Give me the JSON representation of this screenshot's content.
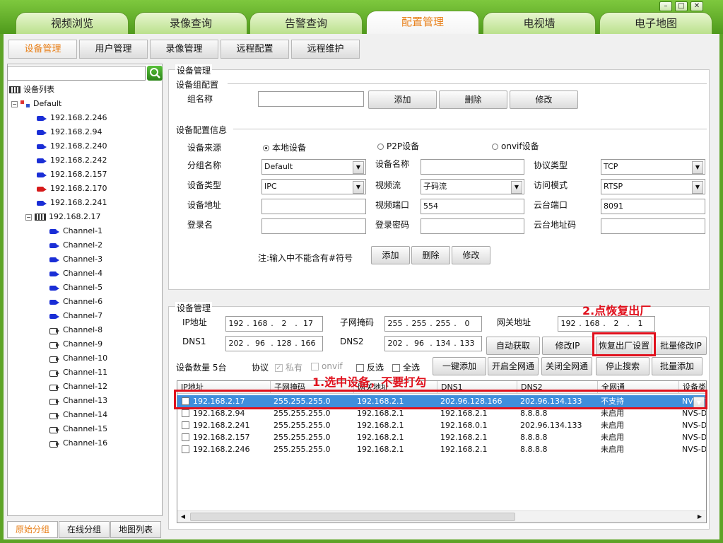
{
  "main_tabs": [
    "视频浏览",
    "录像查询",
    "告警查询",
    "配置管理",
    "电视墙",
    "电子地图"
  ],
  "window_buttons": [
    "–",
    "□",
    "✕"
  ],
  "sub_tabs": [
    "设备管理",
    "用户管理",
    "录像管理",
    "远程配置",
    "远程维护"
  ],
  "tree": {
    "root_label": "设备列表",
    "group_label": "Default",
    "devices": [
      "192.168.2.246",
      "192.168.2.94",
      "192.168.2.240",
      "192.168.2.242",
      "192.168.2.157",
      "192.168.2.170",
      "192.168.2.241"
    ],
    "nvr_label": "192.168.2.17",
    "channels": [
      "Channel-1",
      "Channel-2",
      "Channel-3",
      "Channel-4",
      "Channel-5",
      "Channel-6",
      "Channel-7",
      "Channel-8",
      "Channel-9",
      "Channel-10",
      "Channel-11",
      "Channel-12",
      "Channel-13",
      "Channel-14",
      "Channel-15",
      "Channel-16"
    ]
  },
  "bottom_tabs": [
    "原始分组",
    "在线分组",
    "地图列表"
  ],
  "device_config": {
    "title": "设备管理",
    "group_section": "设备组配置",
    "group_name_label": "组名称",
    "add": "添加",
    "delete": "删除",
    "modify": "修改",
    "info_section": "设备配置信息",
    "source_label": "设备来源",
    "source_local": "本地设备",
    "source_p2p": "P2P设备",
    "source_onvif": "onvif设备",
    "group_label": "分组名称",
    "group_value": "Default",
    "device_name_label": "设备名称",
    "protocol_label": "协议类型",
    "protocol_value": "TCP",
    "device_type_label": "设备类型",
    "device_type_value": "IPC",
    "stream_label": "视频流",
    "stream_value": "子码流",
    "access_label": "访问模式",
    "access_value": "RTSP",
    "address_label": "设备地址",
    "video_port_label": "视频端口",
    "video_port_value": "554",
    "ptz_port_label": "云台端口",
    "ptz_port_value": "8091",
    "login_label": "登录名",
    "password_label": "登录密码",
    "ptz_addr_label": "云台地址码",
    "note": "注:输入中不能含有#符号"
  },
  "net_config": {
    "title": "设备管理",
    "ip_label": "IP地址",
    "ip": [
      "192",
      "168",
      "2",
      "17"
    ],
    "mask_label": "子网掩码",
    "mask": [
      "255",
      "255",
      "255",
      "0"
    ],
    "gateway_label": "网关地址",
    "gateway": [
      "192",
      "168",
      "2",
      "1"
    ],
    "dns1_label": "DNS1",
    "dns1": [
      "202",
      "96",
      "128",
      "166"
    ],
    "dns2_label": "DNS2",
    "dns2": [
      "202",
      "96",
      "134",
      "133"
    ],
    "auto_get": "自动获取",
    "modify_ip": "修改IP",
    "factory_reset": "恢复出厂设置",
    "batch_modify_ip": "批量修改IP",
    "count_label": "设备数量",
    "count_value": "5台",
    "protocol_label": "协议",
    "private": "私有",
    "onvif": "onvif",
    "invert": "反选",
    "select_all": "全选",
    "one_click_add": "一键添加",
    "open_all": "开启全网通",
    "close_all": "关闭全网通",
    "stop_search": "停止搜索",
    "batch_add": "批量添加"
  },
  "table": {
    "columns": [
      "IP地址",
      "子网掩码",
      "网关地址",
      "DNS1",
      "DNS2",
      "全网通",
      "设备类型"
    ],
    "rows": [
      [
        "192.168.2.17",
        "255.255.255.0",
        "192.168.2.1",
        "202.96.128.166",
        "202.96.134.133",
        "不支持",
        "NVR-T"
      ],
      [
        "192.168.2.94",
        "255.255.255.0",
        "192.168.2.1",
        "192.168.2.1",
        "8.8.8.8",
        "未启用",
        "NVS-D"
      ],
      [
        "192.168.2.241",
        "255.255.255.0",
        "192.168.2.1",
        "192.168.0.1",
        "202.96.134.133",
        "未启用",
        "NVS-D"
      ],
      [
        "192.168.2.157",
        "255.255.255.0",
        "192.168.2.1",
        "192.168.2.1",
        "8.8.8.8",
        "未启用",
        "NVS-D"
      ],
      [
        "192.168.2.246",
        "255.255.255.0",
        "192.168.2.1",
        "192.168.2.1",
        "8.8.8.8",
        "未启用",
        "NVS-D"
      ]
    ]
  },
  "annotations": {
    "step1": "1.选中设备，不要打勾",
    "step2": "2.点恢复出厂"
  },
  "colors": {
    "accent": "#e8801a",
    "annotation": "#e0101c",
    "selected_row": "#3f8edc"
  }
}
